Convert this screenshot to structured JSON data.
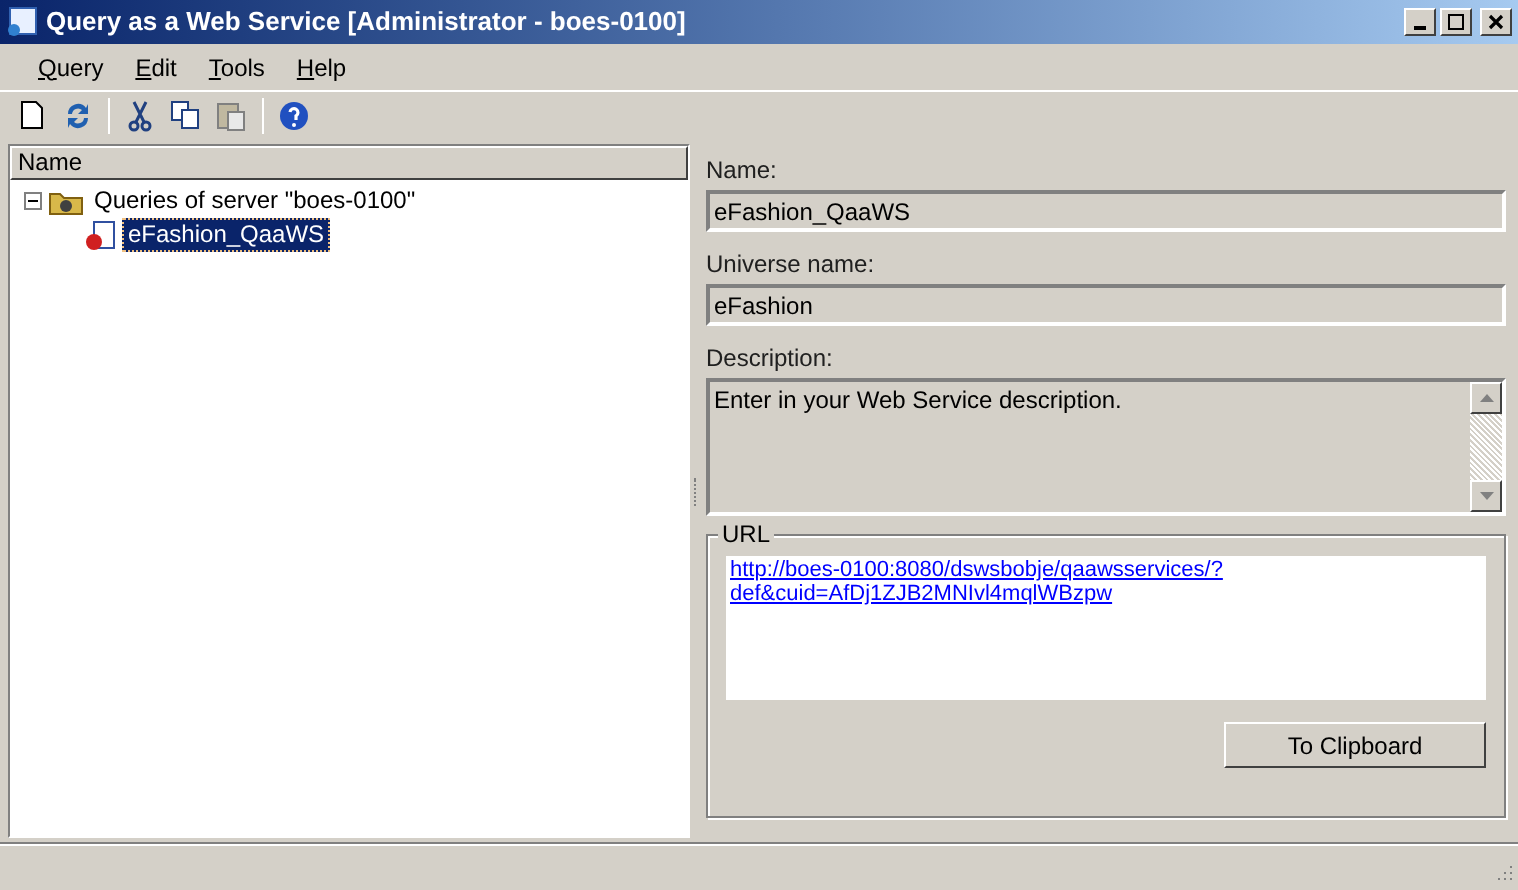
{
  "window": {
    "title": "Query as a Web Service [Administrator - boes-0100]"
  },
  "menu": [
    "Query",
    "Edit",
    "Tools",
    "Help"
  ],
  "tree": {
    "column": "Name",
    "items": [
      {
        "label": "Queries of server \"boes-0100\"",
        "kind": "folder",
        "expanded": true,
        "selected": false,
        "children": [
          {
            "label": "eFashion_QaaWS",
            "kind": "query",
            "selected": true
          }
        ]
      }
    ]
  },
  "details": {
    "name_label": "Name:",
    "name_value": "eFashion_QaaWS",
    "universe_label": "Universe name:",
    "universe_value": "eFashion",
    "description_label": "Description:",
    "description_value": "Enter in your Web Service description.",
    "url_label": "URL",
    "url_lines": [
      "http://boes-0100:8080/dswsbobje/qaawsservices/?",
      "def&cuid=AfDj1ZJB2MNIvl4mqlWBzpw"
    ],
    "clipboard_button": "To Clipboard"
  }
}
